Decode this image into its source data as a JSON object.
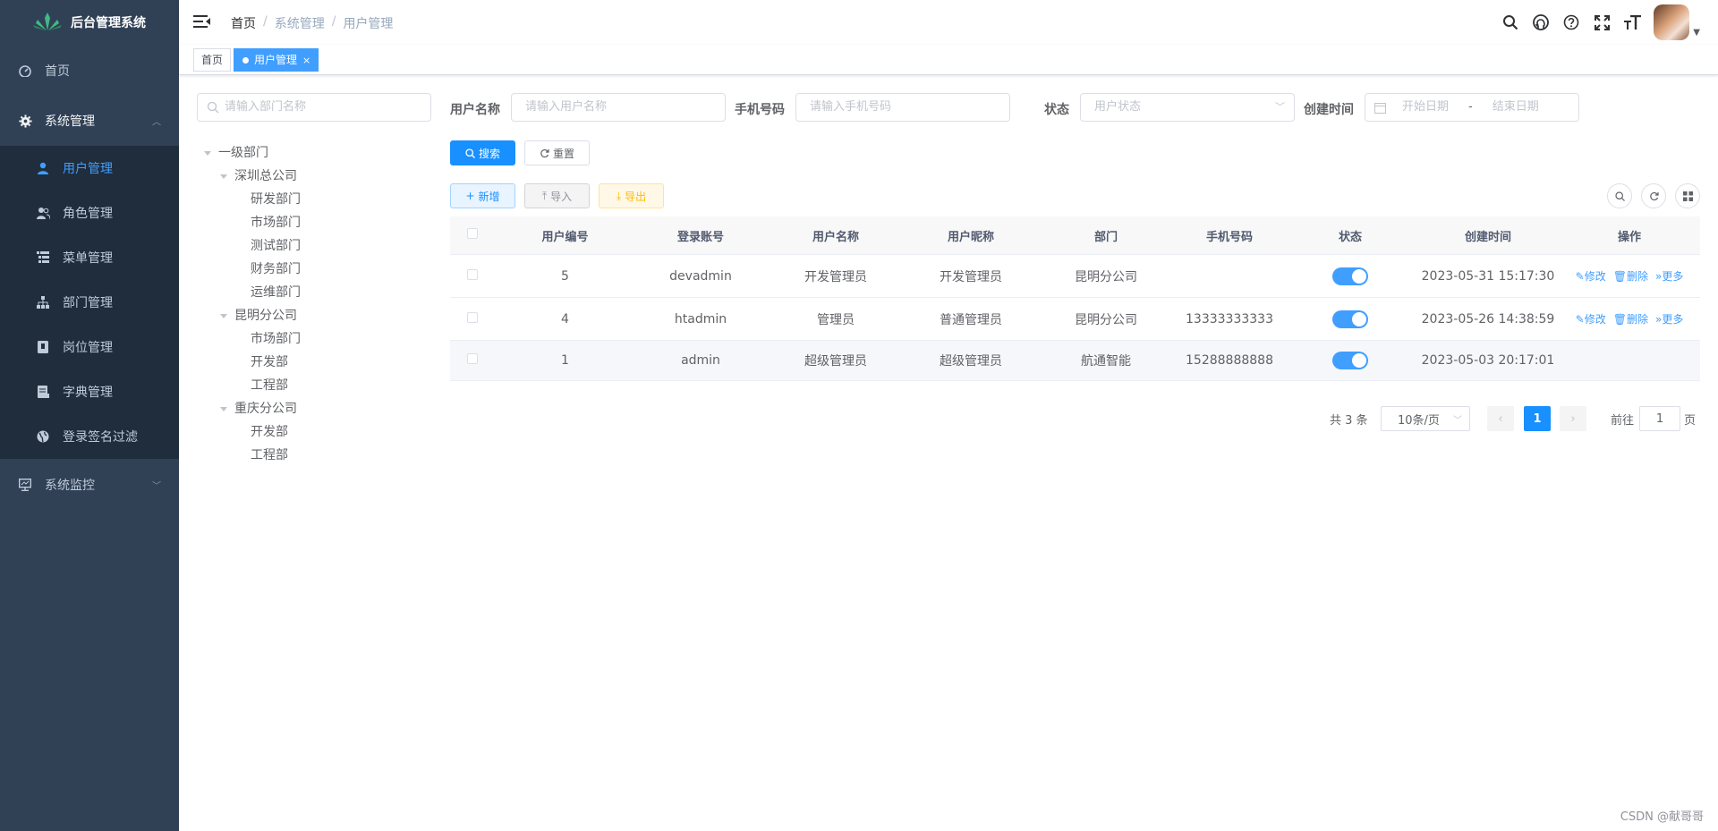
{
  "sidebar": {
    "logo_text": "后台管理系统",
    "items": [
      {
        "label": "首页"
      },
      {
        "label": "系统管理"
      },
      {
        "label": "用户管理"
      },
      {
        "label": "角色管理"
      },
      {
        "label": "菜单管理"
      },
      {
        "label": "部门管理"
      },
      {
        "label": "岗位管理"
      },
      {
        "label": "字典管理"
      },
      {
        "label": "登录签名过滤"
      },
      {
        "label": "系统监控"
      }
    ]
  },
  "breadcrumb": [
    "首页",
    "系统管理",
    "用户管理"
  ],
  "tags": {
    "home": "首页",
    "active": "用户管理",
    "close": "×"
  },
  "dept_tree": {
    "search_placeholder": "请输入部门名称",
    "nodes": [
      "一级部门",
      "深圳总公司",
      "研发部门",
      "市场部门",
      "测试部门",
      "财务部门",
      "运维部门",
      "昆明分公司",
      "市场部门",
      "开发部",
      "工程部",
      "重庆分公司",
      "开发部",
      "工程部"
    ]
  },
  "query": {
    "username_label": "用户名称",
    "username_placeholder": "请输入用户名称",
    "phone_label": "手机号码",
    "phone_placeholder": "请输入手机号码",
    "status_label": "状态",
    "status_placeholder": "用户状态",
    "created_label": "创建时间",
    "start_placeholder": "开始日期",
    "range_sep": "-",
    "end_placeholder": "结束日期",
    "search_btn": "搜索",
    "reset_btn": "重置"
  },
  "toolbar": {
    "add": "新增",
    "import": "导入",
    "export": "导出"
  },
  "table": {
    "headers": [
      "用户编号",
      "登录账号",
      "用户名称",
      "用户昵称",
      "部门",
      "手机号码",
      "状态",
      "创建时间",
      "操作"
    ],
    "rows": [
      {
        "id": "5",
        "account": "devadmin",
        "name": "开发管理员",
        "nick": "开发管理员",
        "dept": "昆明分公司",
        "phone": "",
        "status_on": true,
        "created": "2023-05-31 15:17:30",
        "ops": true
      },
      {
        "id": "4",
        "account": "htadmin",
        "name": "管理员",
        "nick": "普通管理员",
        "dept": "昆明分公司",
        "phone": "13333333333",
        "status_on": true,
        "created": "2023-05-26 14:38:59",
        "ops": true
      },
      {
        "id": "1",
        "account": "admin",
        "name": "超级管理员",
        "nick": "超级管理员",
        "dept": "航通智能",
        "phone": "15288888888",
        "status_on": true,
        "created": "2023-05-03 20:17:01",
        "ops": false
      }
    ],
    "op_edit": "修改",
    "op_delete": "删除",
    "op_more": "更多"
  },
  "pagination": {
    "total": "共 3 条",
    "page_size": "10条/页",
    "current": "1",
    "goto_prefix": "前往",
    "goto_value": "1",
    "goto_suffix": "页"
  },
  "watermark": "CSDN @献哥哥",
  "colors": {
    "sidebar_bg": "#304156",
    "submenu_bg": "#1f2d3d",
    "primary": "#1890ff",
    "active_tab": "#409eff"
  }
}
